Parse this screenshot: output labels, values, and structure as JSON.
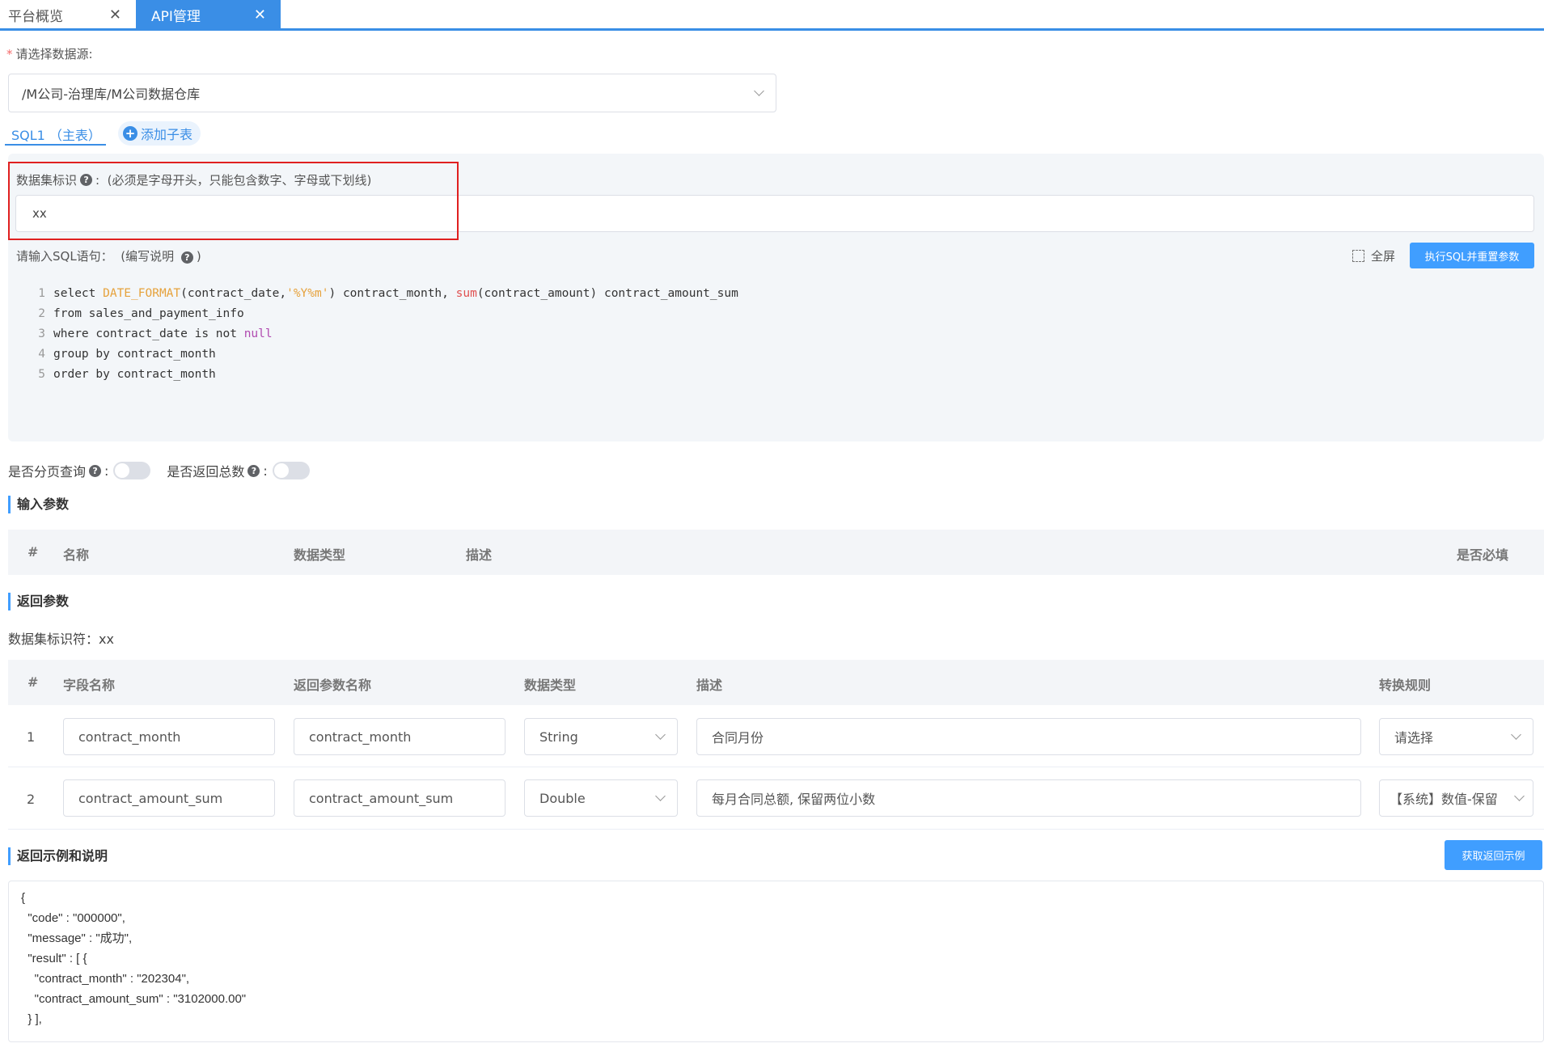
{
  "tabs": [
    {
      "label": "平台概览"
    },
    {
      "label": "API管理"
    }
  ],
  "datasource": {
    "label": "请选择数据源:",
    "value": "/M公司-治理库/M公司数据仓库"
  },
  "sql_tabs": {
    "main": "SQL1 （主表）",
    "add": "添加子表"
  },
  "dataset": {
    "label": "数据集标识",
    "hint": "(必须是字母开头，只能包含数字、字母或下划线)",
    "value": "xx"
  },
  "sql": {
    "label": "请输入SQL语句：",
    "guide_open": "(编写说明",
    "guide_close": ")",
    "fullscreen": "全屏",
    "run_button": "执行SQL并重置参数"
  },
  "code_lines": [
    {
      "n": "1",
      "parts": [
        [
          "select ",
          ""
        ],
        [
          "DATE_FORMAT",
          "kw-orange"
        ],
        [
          "(contract_date,",
          ""
        ],
        [
          "'%Y%m'",
          "kw-orange"
        ],
        [
          ") contract_month, ",
          ""
        ],
        [
          "sum",
          "kw-red"
        ],
        [
          "(contract_amount) contract_amount_sum",
          ""
        ]
      ]
    },
    {
      "n": "2",
      "parts": [
        [
          "from sales_and_payment_info",
          ""
        ]
      ]
    },
    {
      "n": "3",
      "parts": [
        [
          "where contract_date is not ",
          ""
        ],
        [
          "null",
          "kw-purple"
        ]
      ]
    },
    {
      "n": "4",
      "parts": [
        [
          "group by contract_month",
          ""
        ]
      ]
    },
    {
      "n": "5",
      "parts": [
        [
          "order by contract_month",
          ""
        ]
      ]
    }
  ],
  "switches": {
    "paging_label": "是否分页查询",
    "total_label": "是否返回总数",
    "paging_on": false,
    "total_on": false
  },
  "input_params": {
    "title": "输入参数",
    "headers": [
      "#",
      "名称",
      "数据类型",
      "描述",
      "是否必填"
    ]
  },
  "return_params": {
    "title": "返回参数",
    "identifier_label": "数据集标识符：",
    "identifier_value": "xx",
    "headers": [
      "#",
      "字段名称",
      "返回参数名称",
      "数据类型",
      "描述",
      "转换规则"
    ],
    "rows": [
      {
        "index": "1",
        "field": "contract_month",
        "name": "contract_month",
        "type": "String",
        "desc": "合同月份",
        "rule": "请选择"
      },
      {
        "index": "2",
        "field": "contract_amount_sum",
        "name": "contract_amount_sum",
        "type": "Double",
        "desc": "每月合同总额, 保留两位小数",
        "rule": "【系统】数值-保留"
      }
    ]
  },
  "example": {
    "title": "返回示例和说明",
    "button": "获取返回示例",
    "json_text": "{\n  \"code\" : \"000000\",\n  \"message\" : \"成功\",\n  \"result\" : [ {\n    \"contract_month\" : \"202304\",\n    \"contract_amount_sum\" : \"3102000.00\"\n  } ],"
  },
  "colors": {
    "accent": "#409eff",
    "highlight_box": "#e02020"
  }
}
